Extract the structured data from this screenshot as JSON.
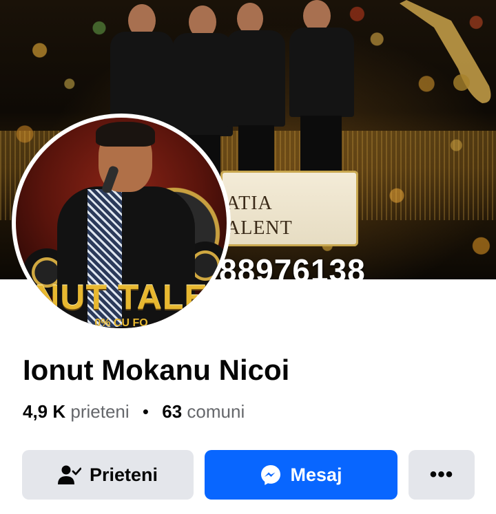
{
  "cover": {
    "banner_line1": "ATIA",
    "banner_line2": "ALENT",
    "phone": "88976138"
  },
  "avatar": {
    "text": "NUT TALE",
    "subtext": "0% CU FO"
  },
  "profile": {
    "name": "Ionut Mokanu Nicoi",
    "friends_count": "4,9 K",
    "friends_label": "prieteni",
    "separator": "•",
    "communities_count": "63",
    "communities_label": "comuni"
  },
  "actions": {
    "friends_label": "Prieteni",
    "message_label": "Mesaj",
    "more_label": "•••"
  },
  "icons": {
    "friends": "person-check-icon",
    "message": "messenger-icon",
    "more": "more-dots-icon"
  },
  "colors": {
    "primary": "#0866ff",
    "secondary_button": "#e4e6eb",
    "text_primary": "#050505",
    "text_secondary": "#65676b"
  }
}
